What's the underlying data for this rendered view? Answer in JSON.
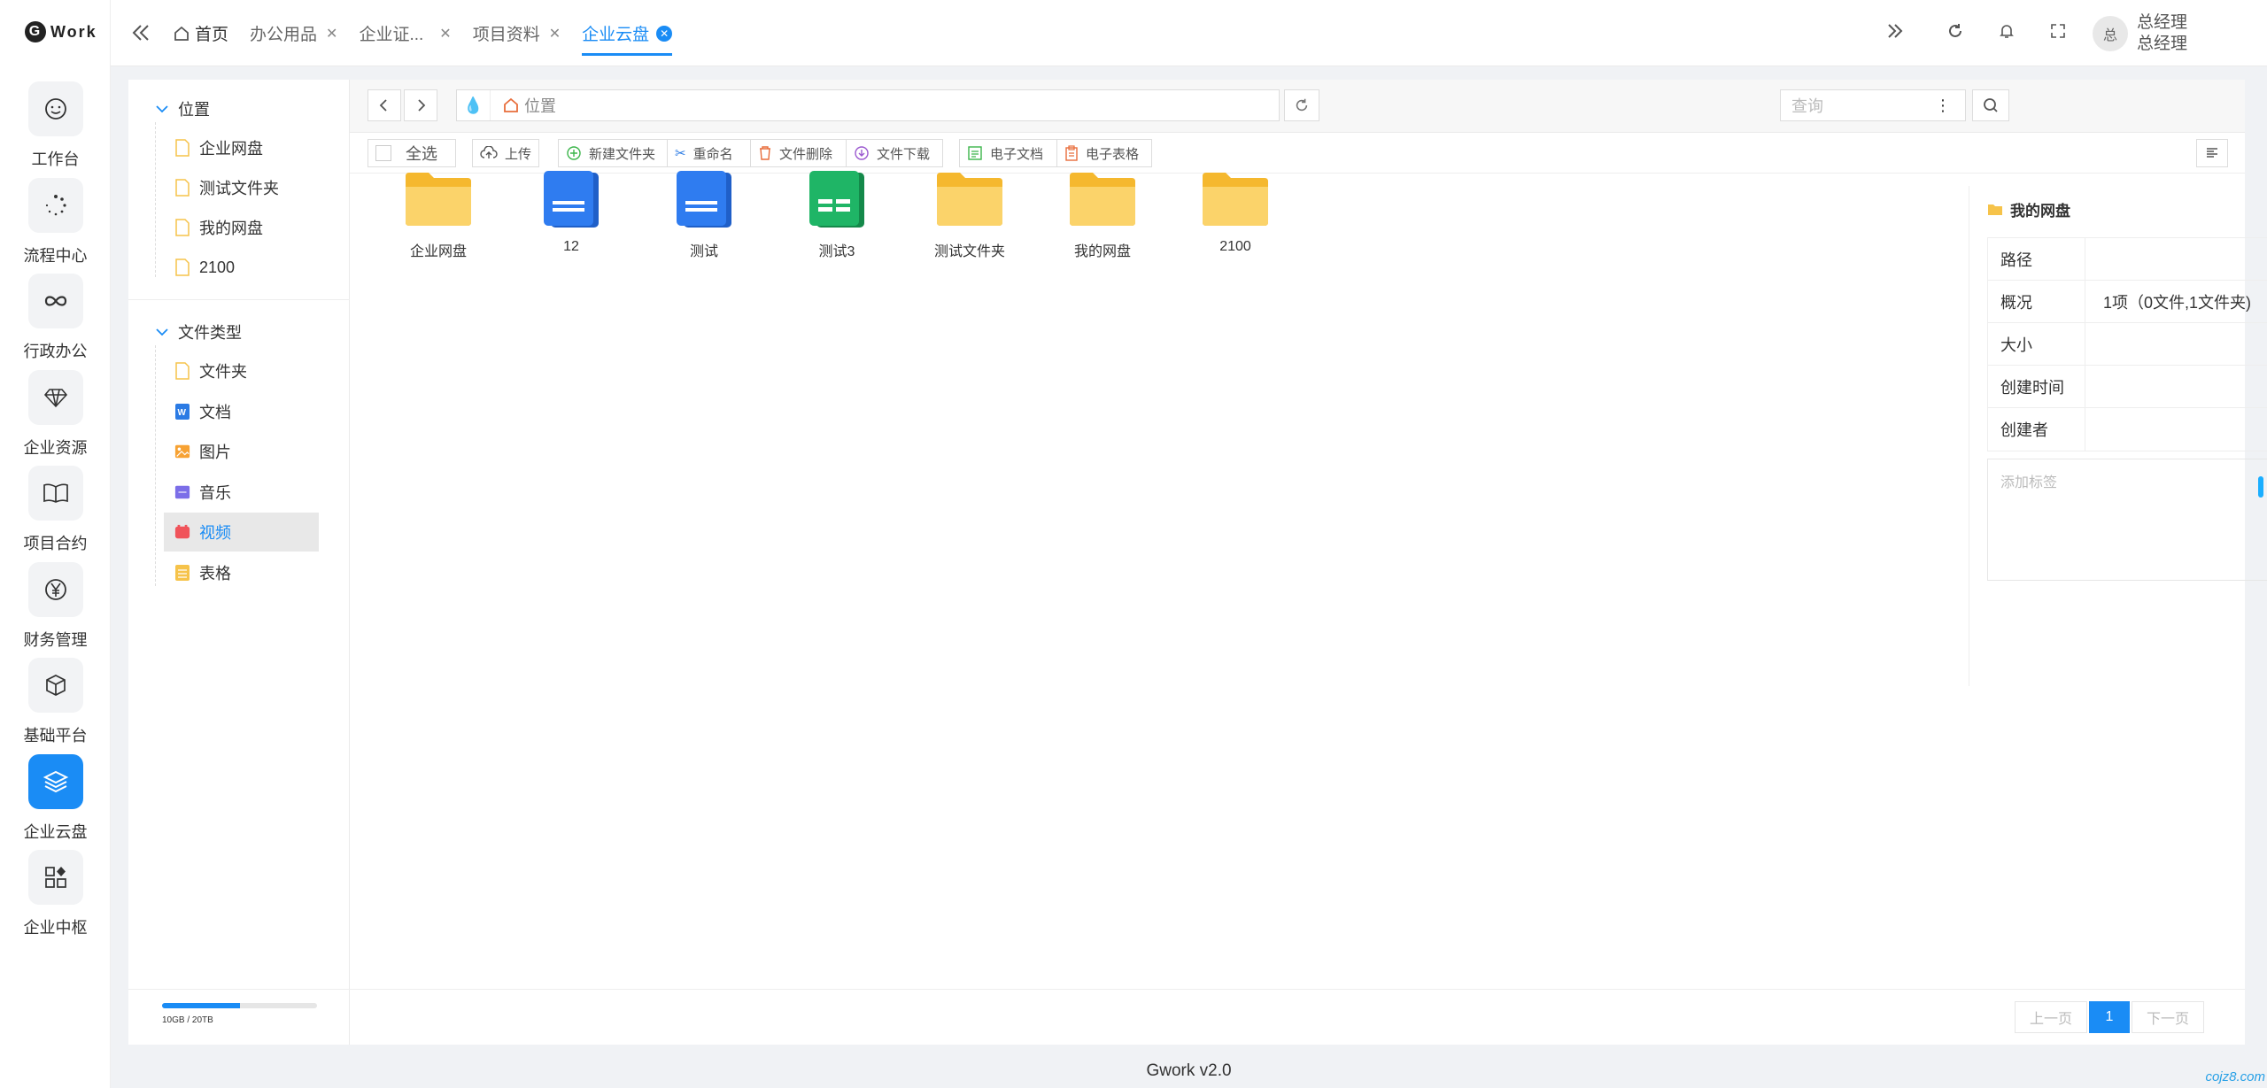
{
  "app": {
    "logo": "Work"
  },
  "rail": {
    "items": [
      {
        "label": "工作台",
        "icon": "smile-icon"
      },
      {
        "label": "流程中心",
        "icon": "spinner-icon"
      },
      {
        "label": "行政办公",
        "icon": "infinity-icon"
      },
      {
        "label": "企业资源",
        "icon": "diamond-icon"
      },
      {
        "label": "项目合约",
        "icon": "book-icon"
      },
      {
        "label": "财务管理",
        "icon": "yen-icon"
      },
      {
        "label": "基础平台",
        "icon": "cube-icon"
      },
      {
        "label": "企业云盘",
        "icon": "layers-icon",
        "active": true
      },
      {
        "label": "企业中枢",
        "icon": "apps-icon"
      }
    ]
  },
  "tabs": [
    {
      "label": "首页"
    },
    {
      "label": "办公用品"
    },
    {
      "label": "企业证..."
    },
    {
      "label": "项目资料"
    },
    {
      "label": "企业云盘",
      "active": true
    }
  ],
  "user": {
    "avatar": "总",
    "name": "总经理",
    "role": "总经理"
  },
  "tree": {
    "location_title": "位置",
    "locations": [
      "企业网盘",
      "测试文件夹",
      "我的网盘",
      "2100"
    ],
    "types_title": "文件类型",
    "types": [
      {
        "label": "文件夹",
        "color": "#f6c34a"
      },
      {
        "label": "文档",
        "color": "#2b7be4"
      },
      {
        "label": "图片",
        "color": "#f7a233"
      },
      {
        "label": "音乐",
        "color": "#7b6ee8"
      },
      {
        "label": "视频",
        "color": "#f0535a",
        "active": true
      },
      {
        "label": "表格",
        "color": "#f6c34a"
      }
    ]
  },
  "storage": {
    "text": "10GB / 20TB",
    "used_fraction": 0.5
  },
  "pathbar": {
    "path": "位置",
    "search_placeholder": "查询"
  },
  "toolbar": {
    "select_all": "全选",
    "upload": "上传",
    "new_folder": "新建文件夹",
    "rename": "重命名",
    "delete": "文件删除",
    "download": "文件下载",
    "e_doc": "电子文档",
    "e_sheet": "电子表格"
  },
  "files": [
    {
      "name": "企业网盘",
      "type": "folder"
    },
    {
      "name": "12",
      "type": "doc"
    },
    {
      "name": "测试",
      "type": "doc"
    },
    {
      "name": "测试3",
      "type": "sheet"
    },
    {
      "name": "测试文件夹",
      "type": "folder"
    },
    {
      "name": "我的网盘",
      "type": "folder"
    },
    {
      "name": "2100",
      "type": "folder"
    }
  ],
  "info": {
    "title": "我的网盘",
    "rows": [
      {
        "key": "路径",
        "value": ""
      },
      {
        "key": "概况",
        "value": "1项（0文件,1文件夹)"
      },
      {
        "key": "大小",
        "value": ""
      },
      {
        "key": "创建时间",
        "value": ""
      },
      {
        "key": "创建者",
        "value": ""
      }
    ],
    "tag_placeholder": "添加标签"
  },
  "pager": {
    "prev": "上一页",
    "current": "1",
    "next": "下一页"
  },
  "footer": {
    "text": "Gwork v2.0"
  },
  "watermark": "cojz8.com"
}
